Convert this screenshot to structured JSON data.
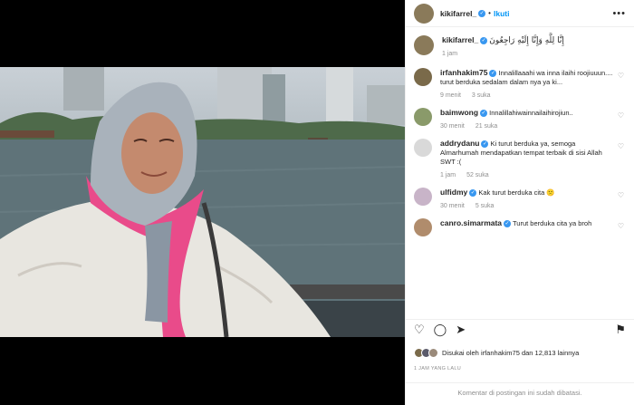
{
  "header": {
    "username": "kikifarrel_",
    "follow_label": "Ikuti",
    "more_label": "•••",
    "separator": "•"
  },
  "caption": {
    "username": "kikifarrel_",
    "text": "إِنَّا لِلَّهِ وَإِنَّا إِلَيْهِ رَاجِعُونَ",
    "time": "1 jam"
  },
  "comments": [
    {
      "username": "irfanhakim75",
      "text": "Innalillaaahi wa inna ilaihi roojiuuun.... turut berduka sedalam dalam nya ya ki...",
      "time": "9 menit",
      "likes": "3 suka",
      "avatar_color": "#7a6a4a"
    },
    {
      "username": "baimwong",
      "text": "Innalillahiwainnailaihirojiun..",
      "time": "30 menit",
      "likes": "21 suka",
      "avatar_color": "#8a9a6a"
    },
    {
      "username": "addrydanu",
      "text": "Ki turut berduka ya, semoga Almarhumah mendapatkan tempat terbaik di sisi Allah SWT :(",
      "time": "1 jam",
      "likes": "52 suka",
      "avatar_color": "#d9d9d9"
    },
    {
      "username": "ulfidmy",
      "text": "Kak turut berduka cita 🙁",
      "time": "30 menit",
      "likes": "5 suka",
      "avatar_color": "#c8b4c8"
    },
    {
      "username": "canro.simarmata",
      "text": "Turut berduka cita ya broh",
      "time": "",
      "likes": "",
      "avatar_color": "#b08c6c"
    }
  ],
  "actions": {
    "like_icon": "♡",
    "comment_icon": "◯",
    "share_icon": "➤",
    "save_icon": "⚑"
  },
  "likes": {
    "text": "Disukai oleh irfanhakim75 dan 12,813 lainnya"
  },
  "timestamp": "1 JAM YANG LALU",
  "comments_closed": "Komentar di postingan ini sudah dibatasi.",
  "colors": {
    "accent": "#0095f6",
    "verified": "#3897f0",
    "muted": "#8e8e8e",
    "text": "#262626"
  }
}
